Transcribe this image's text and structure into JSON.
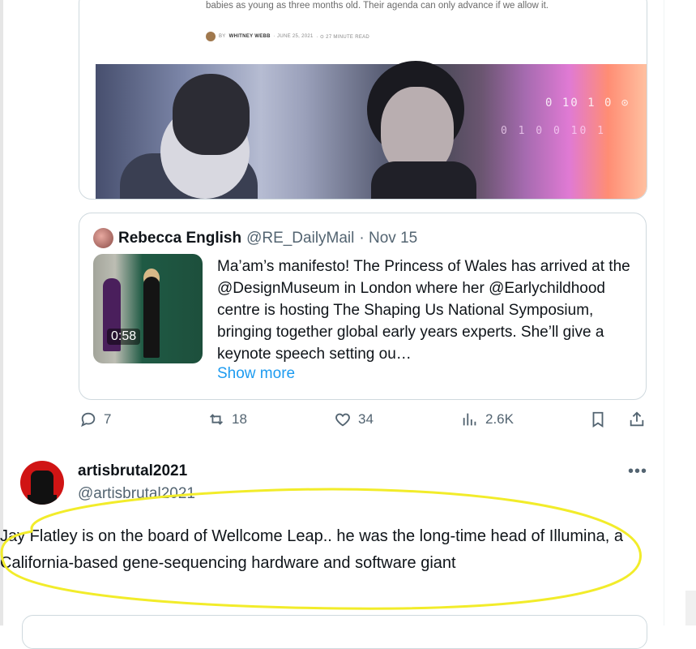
{
  "article": {
    "excerpt": "babies as young as three months old. Their agenda can only advance if we allow it.",
    "by": "BY",
    "author": "WHITNEY WEBB",
    "date": "· JUNE 25, 2021",
    "readtime": "· ⊙ 27 MINUTE READ",
    "image_code_1": "0 10 1 0 ⊙",
    "image_code_2": "0 1 0   0 10 1"
  },
  "quoted_tweet": {
    "author_name": "Rebecca English",
    "handle": "@RE_DailyMail",
    "date": "· Nov 15",
    "video_duration": "0:58",
    "text": "Ma’am’s manifesto! The Princess of Wales has arrived at the @DesignMuseum in London where her @Earlychildhood centre is hosting The Shaping Us National Symposium, bringing together global early years experts. She’ll give a keynote speech setting ou…",
    "show_more": "Show more"
  },
  "actions": {
    "replies": "7",
    "reposts": "18",
    "likes": "34",
    "views": "2.6K"
  },
  "reply": {
    "name": "artisbrutal2021",
    "handle": "@artisbrutal2021",
    "more": "•••",
    "text": "Jay Flatley is on the board of Wellcome Leap.. he was the long-time head of Illumina, a California-based gene-sequencing hardware and software giant"
  },
  "colors": {
    "link": "#1d9bf0",
    "muted": "#536471",
    "highlight": "#f2ec2a"
  }
}
